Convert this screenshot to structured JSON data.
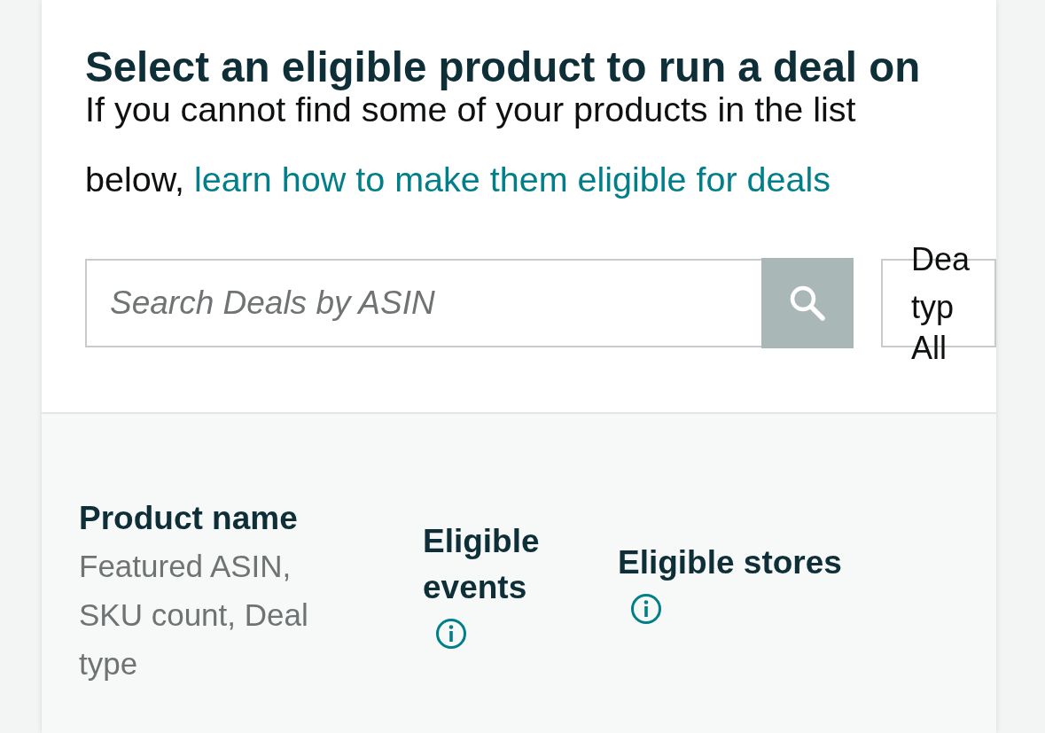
{
  "heading": {
    "title": "Select an eligible product to run a deal on",
    "text": "If you cannot find some of your products in the list below,",
    "link": "learn how to make them eligible for deals"
  },
  "search": {
    "placeholder": "Search Deals by ASIN"
  },
  "deal_type_filter": {
    "label_lines": [
      "Dea",
      "typ"
    ],
    "value": "All"
  },
  "table": {
    "columns": [
      {
        "title": "Product name",
        "subtitle": "Featured ASIN, SKU count, Deal type",
        "info": false
      },
      {
        "title": "Eligible events",
        "info": true
      },
      {
        "title": "Eligible stores",
        "info": true
      }
    ]
  }
}
